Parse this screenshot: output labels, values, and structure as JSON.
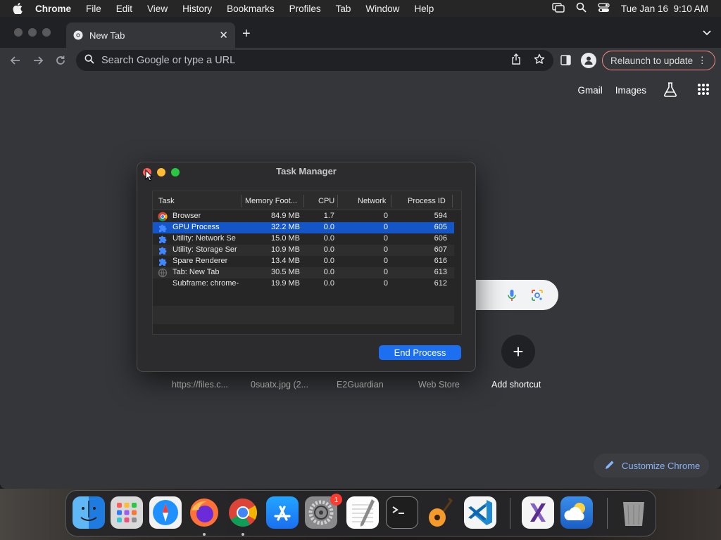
{
  "menubar": {
    "app": "Chrome",
    "items": [
      "File",
      "Edit",
      "View",
      "History",
      "Bookmarks",
      "Profiles",
      "Tab",
      "Window",
      "Help"
    ],
    "datetime": "Tue Jan 16  9:10 AM"
  },
  "browser": {
    "tab_title": "New Tab",
    "omnibox_placeholder": "Search Google or type a URL",
    "relaunch_label": "Relaunch to update"
  },
  "ntp": {
    "gmail": "Gmail",
    "images": "Images",
    "shortcuts": [
      "https://files.c...",
      "0suatx.jpg (2...",
      "E2Guardian",
      "Web Store"
    ],
    "add_shortcut": "Add shortcut",
    "customize": "Customize Chrome"
  },
  "task_manager": {
    "title": "Task Manager",
    "columns": [
      "Task",
      "Memory Foot...",
      "CPU",
      "Network",
      "Process ID"
    ],
    "rows": [
      {
        "task": "Browser",
        "memory": "84.9 MB",
        "cpu": "1.7",
        "network": "0",
        "pid": "594",
        "icon": "chrome-icon"
      },
      {
        "task": "GPU Process",
        "memory": "32.2 MB",
        "cpu": "0.0",
        "network": "0",
        "pid": "605",
        "icon": "puzzle-icon",
        "selected": true
      },
      {
        "task": "Utility: Network Se",
        "memory": "15.0 MB",
        "cpu": "0.0",
        "network": "0",
        "pid": "606",
        "icon": "puzzle-icon"
      },
      {
        "task": "Utility: Storage Ser",
        "memory": "10.9 MB",
        "cpu": "0.0",
        "network": "0",
        "pid": "607",
        "icon": "puzzle-icon"
      },
      {
        "task": "Spare Renderer",
        "memory": "13.4 MB",
        "cpu": "0.0",
        "network": "0",
        "pid": "616",
        "icon": "puzzle-icon"
      },
      {
        "task": "Tab: New Tab",
        "memory": "30.5 MB",
        "cpu": "0.0",
        "network": "0",
        "pid": "613",
        "icon": "globe-icon"
      },
      {
        "task": "Subframe: chrome-",
        "memory": "19.9 MB",
        "cpu": "0.0",
        "network": "0",
        "pid": "612",
        "icon": ""
      }
    ],
    "end_process_label": "End Process"
  },
  "dock": {
    "apps": [
      "finder-icon",
      "launchpad-icon",
      "safari-icon",
      "firefox-icon",
      "chrome-icon",
      "app-store-icon",
      "system-settings-icon",
      "textedit-icon",
      "terminal-icon",
      "garageband-icon",
      "vscode-icon",
      "visual-studio-icon",
      "weather-icon",
      "trash-icon"
    ],
    "settings_badge": "1"
  }
}
